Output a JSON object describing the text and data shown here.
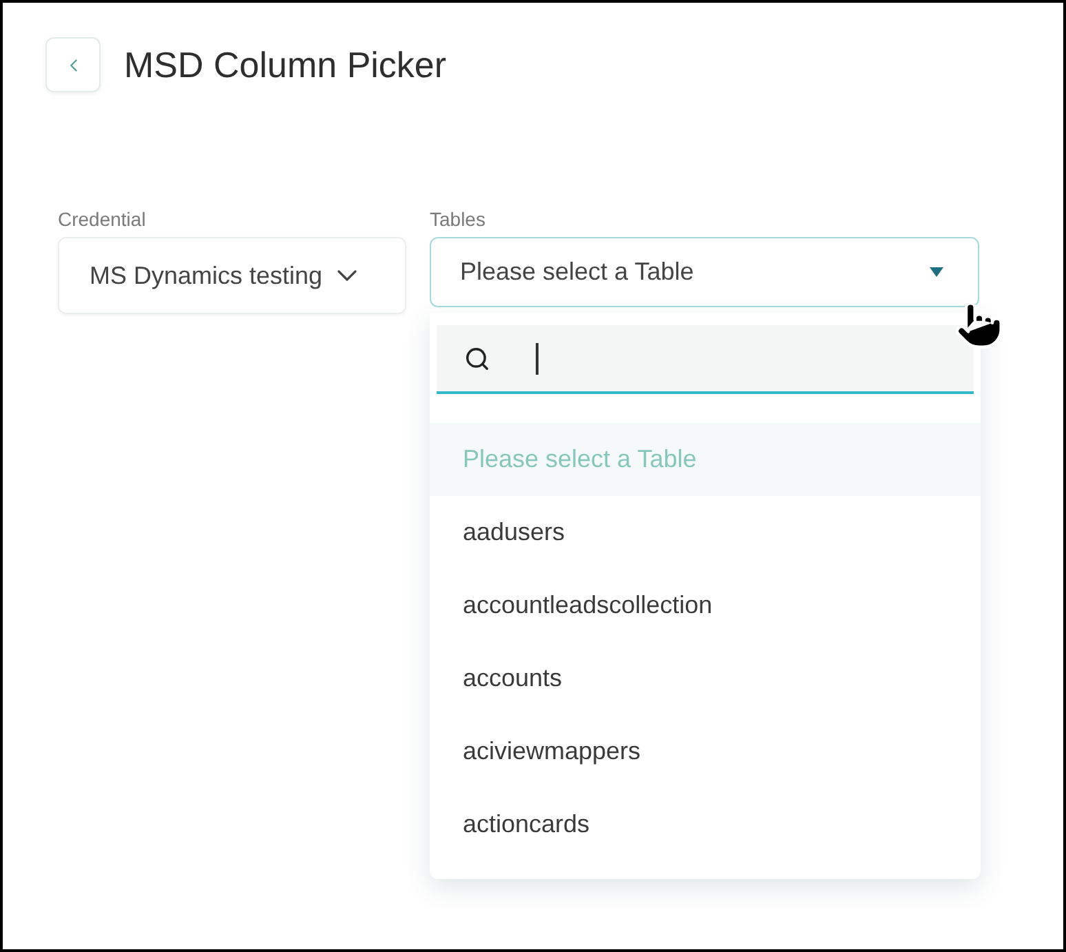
{
  "header": {
    "title": "MSD Column Picker"
  },
  "credential": {
    "label": "Credential",
    "value": "MS Dynamics testing"
  },
  "tables": {
    "label": "Tables",
    "value": "Please select a Table",
    "expanded": true,
    "options": [
      {
        "label": "Please select a Table",
        "selected": true
      },
      {
        "label": "aadusers",
        "selected": false
      },
      {
        "label": "accountleadscollection",
        "selected": false
      },
      {
        "label": "accounts",
        "selected": false
      },
      {
        "label": "aciviewmappers",
        "selected": false
      },
      {
        "label": "actioncards",
        "selected": false
      }
    ]
  }
}
